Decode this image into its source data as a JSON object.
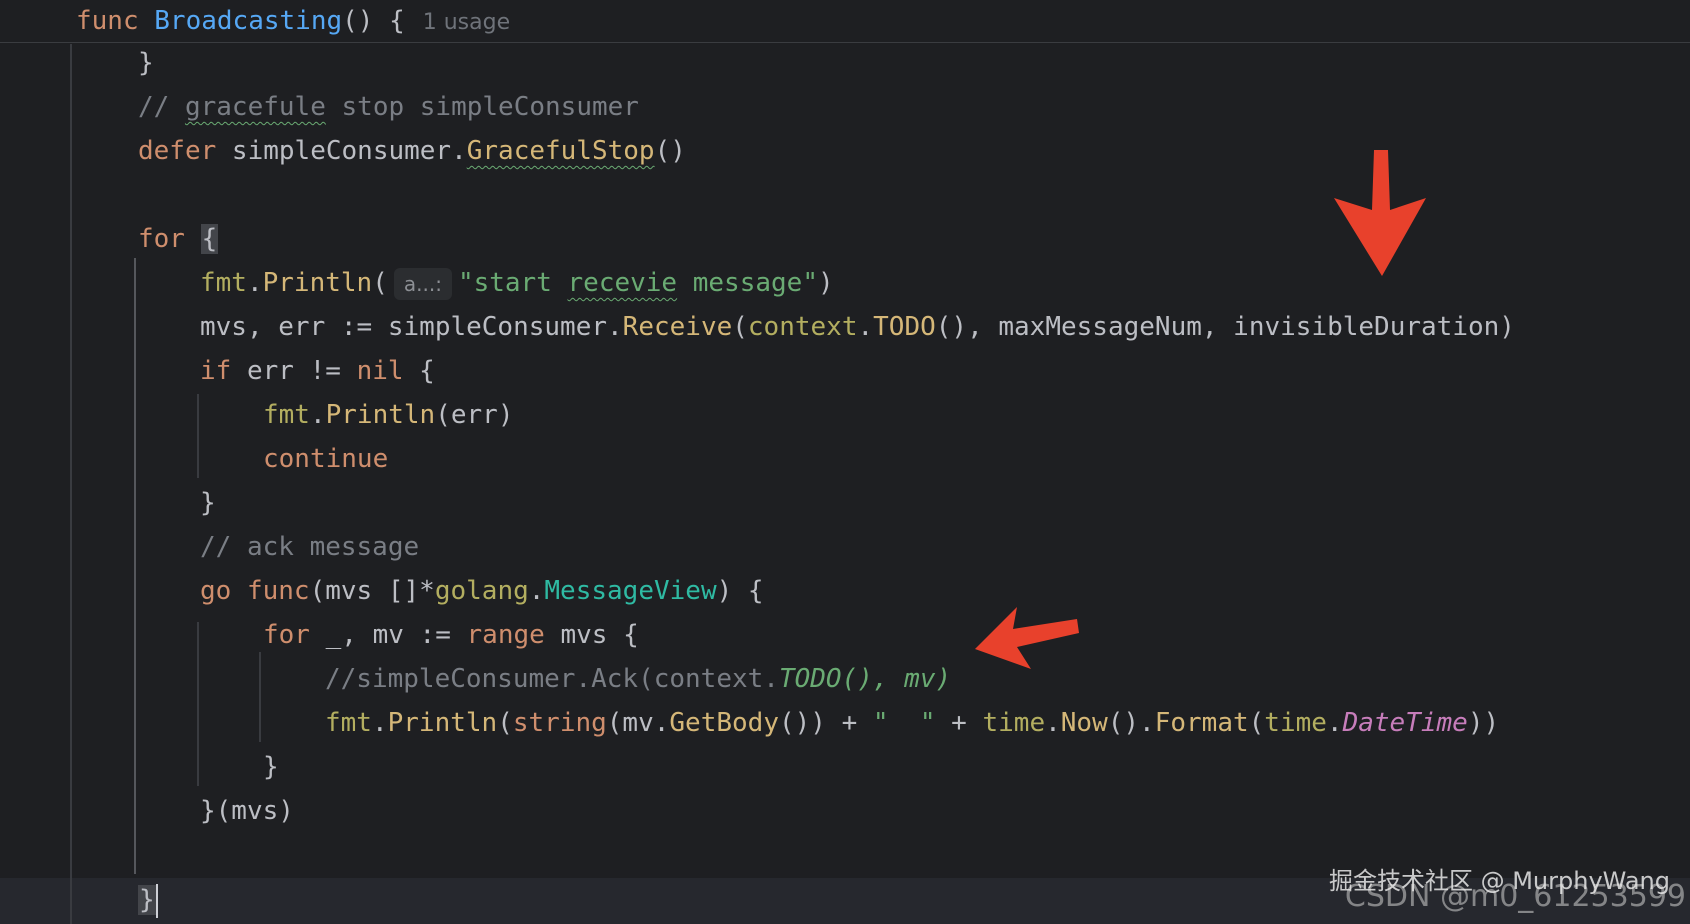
{
  "header": {
    "func_kw": "func",
    "func_name": "Broadcasting",
    "signature_rest": "() {",
    "usage_hint": "1 usage"
  },
  "code": {
    "l1_close": "}",
    "l2_comment_prefix": "// ",
    "l2_comment_word": "gracefule",
    "l2_comment_rest": " stop simpleConsumer",
    "l3_defer": "defer",
    "l3_receiver": " simpleConsumer.",
    "l3_method": "GracefulStop",
    "l3_parens": "()",
    "l5_for": "for",
    "l5_brace": "{",
    "l6_pkg": "fmt",
    "l6_dot": ".",
    "l6_func": "Println",
    "l6_open": "(",
    "l6_param_hint": "a...:",
    "l6_str_open": "\"start ",
    "l6_str_word": "recevie",
    "l6_str_close": " message\"",
    "l6_close": ")",
    "l7_vars": "mvs, ",
    "l7_err": "err",
    "l7_assign": " := simpleConsumer.",
    "l7_method": "Receive",
    "l7_open": "(",
    "l7_ctx": "context",
    "l7_dot": ".",
    "l7_todo": "TODO",
    "l7_rest": "(), maxMessageNum, invisibleDuration)",
    "l8_if": "if",
    "l8_err": " err",
    "l8_ne": " != ",
    "l8_nil": "nil",
    "l8_brace": " {",
    "l9_pkg": "fmt",
    "l9_dot": ".",
    "l9_func": "Println",
    "l9_open": "(",
    "l9_err": "err",
    "l9_close": ")",
    "l10_continue": "continue",
    "l11_close": "}",
    "l12_comment": "// ack message",
    "l13_go": "go",
    "l13_func": " func",
    "l13_open": "(mvs []*",
    "l13_pkg": "golang",
    "l13_dot": ".",
    "l13_type": "MessageView",
    "l13_close": ") {",
    "l14_for": "for",
    "l14_mid": " _, mv := ",
    "l14_range": "range",
    "l14_rest": " mvs {",
    "l15_comment": "//simpleConsumer.Ack(context.",
    "l15_todo_italic": "TODO(), mv)",
    "l16_pkg": "fmt",
    "l16_dot": ".",
    "l16_func": "Println",
    "l16_open": "(",
    "l16_string_kw": "string",
    "l16_mid": "(mv.",
    "l16_getbody": "GetBody",
    "l16_mid2": "()) + ",
    "l16_str": "\"  \"",
    "l16_plus": " + ",
    "l16_time": "time",
    "l16_dot2": ".",
    "l16_now": "Now",
    "l16_mid3": "().",
    "l16_format": "Format",
    "l16_open2": "(",
    "l16_time2": "time",
    "l16_dot3": ".",
    "l16_datetime": "DateTime",
    "l16_close": "))",
    "l17_close": "}",
    "l18_close": "}(mvs)",
    "l20_close": "}"
  },
  "watermark": {
    "primary": "掘金技术社区 @ MurphyWang",
    "secondary": "CSDN @m0_61253599"
  },
  "colors": {
    "background": "#1e1f22",
    "keyword": "#cf8e6d",
    "function_decl": "#56a8f5",
    "string": "#6aab73",
    "comment": "#7a7e85",
    "annotation_arrow": "#e8412c"
  }
}
